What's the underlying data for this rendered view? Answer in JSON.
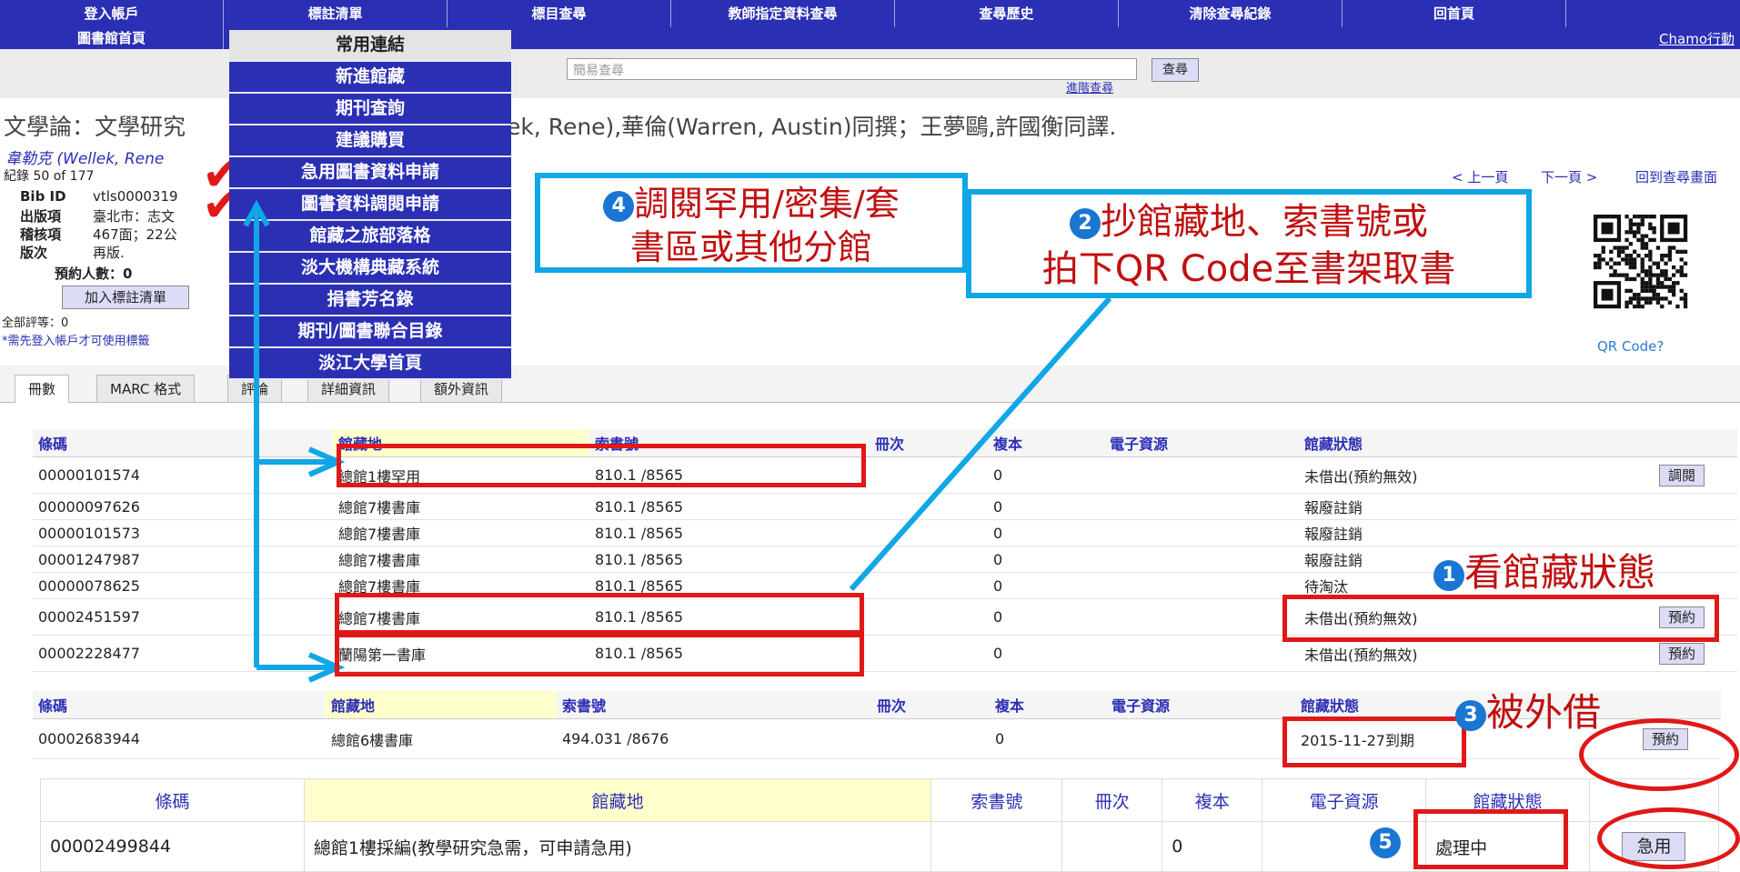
{
  "nav": {
    "row1": [
      "登入帳戶",
      "標註清單",
      "標目查尋",
      "教師指定資料查尋",
      "查尋歷史",
      "清除查尋紀錄",
      "回首頁"
    ],
    "row2": [
      "圖書館首頁"
    ],
    "chamo": "Chamo行動"
  },
  "search": {
    "placeholder": "簡易查尋",
    "button": "查尋",
    "advanced": "進階查尋"
  },
  "dropdown": [
    "常用連結",
    "新進館藏",
    "期刊查詢",
    "建議購買",
    "急用圖書資料申請",
    "圖書資料調閱申請",
    "館藏之旅部落格",
    "淡大機構典藏系統",
    "捐書芳名錄",
    "期刊/圖書聯合目錄",
    "淡江大學首頁"
  ],
  "record": {
    "title_left": "文學論：文學研究",
    "title_right": "lek, Rene),華倫(Warren, Austin)同撰；王夢鷗,許國衡同譯.",
    "author": "韋勒克 (Wellek, Rene",
    "position": "紀錄 50 of 177",
    "bib": [
      {
        "label": "Bib ID",
        "value": "vtls0000319"
      },
      {
        "label": "出版項",
        "value": "臺北市：志文"
      },
      {
        "label": "稽核項",
        "value": "467面；22公"
      },
      {
        "label": "版次",
        "value": "再版."
      }
    ],
    "reserve_count": "預約人數：0",
    "add_button": "加入標註清單",
    "rating": "全部評等：0",
    "login_note": "*需先登入帳戶才可使用標籤"
  },
  "pager": {
    "prev": "< 上一頁",
    "next": "下一頁 >",
    "back": "回到查尋畫面"
  },
  "qr_label": "QR Code?",
  "tabs": [
    "冊數",
    "MARC 格式",
    "評論",
    "詳細資訊",
    "額外資訊"
  ],
  "table_headers": [
    "條碼",
    "館藏地",
    "索書號",
    "冊次",
    "複本",
    "電子資源",
    "館藏狀態"
  ],
  "table1_rows": [
    {
      "barcode": "00000101574",
      "location": "總館1樓罕用",
      "call": "810.1 /8565",
      "copy": "0",
      "status": "未借出(預約無效)",
      "action": "調閱"
    },
    {
      "barcode": "00000097626",
      "location": "總館7樓書庫",
      "call": "810.1 /8565",
      "copy": "0",
      "status": "報廢註銷",
      "action": ""
    },
    {
      "barcode": "00000101573",
      "location": "總館7樓書庫",
      "call": "810.1 /8565",
      "copy": "0",
      "status": "報廢註銷",
      "action": ""
    },
    {
      "barcode": "00001247987",
      "location": "總館7樓書庫",
      "call": "810.1 /8565",
      "copy": "0",
      "status": "報廢註銷",
      "action": ""
    },
    {
      "barcode": "00000078625",
      "location": "總館7樓書庫",
      "call": "810.1 /8565",
      "copy": "0",
      "status": "待淘汰",
      "action": ""
    },
    {
      "barcode": "00002451597",
      "location": "總館7樓書庫",
      "call": "810.1 /8565",
      "copy": "0",
      "status": "未借出(預約無效)",
      "action": "預約"
    },
    {
      "barcode": "00002228477",
      "location": "蘭陽第一書庫",
      "call": "810.1 /8565",
      "copy": "0",
      "status": "未借出(預約無效)",
      "action": "預約"
    }
  ],
  "table2_row": {
    "barcode": "00002683944",
    "location": "總館6樓書庫",
    "call": "494.031 /8676",
    "copy": "0",
    "status": "2015-11-27到期",
    "action": "預約"
  },
  "table3_row": {
    "barcode": "00002499844",
    "location": "總館1樓採編(教學研究急需，可申請急用)",
    "call": "",
    "copy": "0",
    "status": "處理中",
    "action": "急用"
  },
  "annotations": {
    "a1": "看館藏狀態",
    "a2_line1": "抄館藏地、索書號或",
    "a2_line2": "拍下QR Code至書架取書",
    "a3": "被外借",
    "a4_line1": "調閱罕用/密集/套",
    "a4_line2": "書區或其他分館",
    "n1": "1",
    "n2": "2",
    "n3": "3",
    "n4": "4",
    "n5": "5"
  },
  "colors": {
    "nav": "#2b2fb4",
    "annotation_red": "#e01818",
    "annotation_blue": "#11a6e6"
  }
}
